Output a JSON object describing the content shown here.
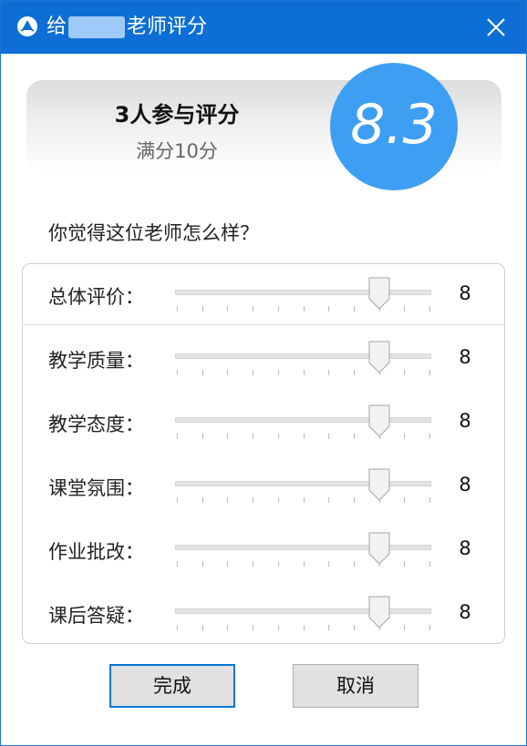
{
  "window": {
    "title_prefix": "给",
    "title_suffix": "老师评分",
    "close_icon": "close-icon",
    "app_icon": "app-logo-icon",
    "titlebar_color": "#0d6fd6"
  },
  "summary": {
    "title": "3人参与评分",
    "subtitle": "满分10分",
    "score": "8.3",
    "score_color": "#3d9ef4"
  },
  "question": "你觉得这位老师怎么样？",
  "slider_range": {
    "min": 0,
    "max": 10
  },
  "ratings": [
    {
      "label": "总体评价：",
      "value": 8
    },
    {
      "label": "教学质量：",
      "value": 8
    },
    {
      "label": "教学态度：",
      "value": 8
    },
    {
      "label": "课堂氛围：",
      "value": 8
    },
    {
      "label": "作业批改：",
      "value": 8
    },
    {
      "label": "课后答疑：",
      "value": 8
    }
  ],
  "buttons": {
    "confirm": "完成",
    "cancel": "取消"
  }
}
